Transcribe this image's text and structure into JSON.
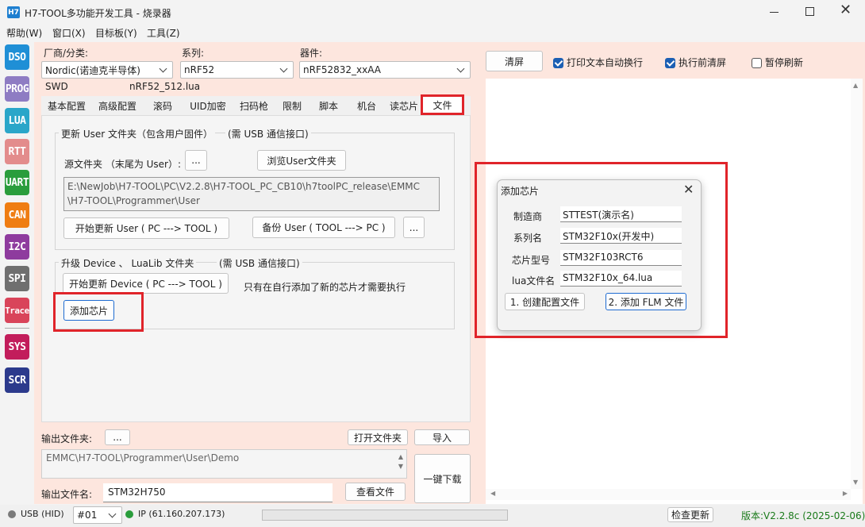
{
  "window": {
    "app_icon": "H7",
    "title": "H7-TOOL多功能开发工具 - 烧录器",
    "controls": [
      "minimize-icon",
      "maximize-icon",
      "close-icon"
    ]
  },
  "menu": [
    "帮助(W)",
    "窗口(X)",
    "目标板(Y)",
    "工具(Z)"
  ],
  "sidebar": [
    {
      "label": "DSO",
      "color": "#1f8fd6"
    },
    {
      "label": "PROG",
      "color": "#8e7cc3"
    },
    {
      "label": "LUA",
      "color": "#2aa6c9"
    },
    {
      "label": "RTT",
      "color": "#e38c8c"
    },
    {
      "label": "UART",
      "color": "#2a9d3c"
    },
    {
      "label": "CAN",
      "color": "#ef7d12"
    },
    {
      "label": "I2C",
      "color": "#8e3b9e"
    },
    {
      "label": "SPI",
      "color": "#6f6f6f"
    },
    {
      "label": "Trace",
      "color": "#d9445a"
    },
    {
      "label": "SYS",
      "color": "#c21d5b"
    },
    {
      "label": "SCR",
      "color": "#2c3a8c"
    }
  ],
  "selectors": {
    "vendor_label": "厂商/分类:",
    "vendor_value": "Nordic(诺迪克半导体)",
    "series_label": "系列:",
    "series_value": "nRF52",
    "device_label": "器件:",
    "device_value": "nRF52832_xxAA",
    "interface": "SWD",
    "lua_file": "nRF52_512.lua"
  },
  "tabs": [
    "基本配置",
    "高级配置",
    "滚码",
    "UID加密",
    "扫码枪",
    "限制",
    "脚本",
    "机台",
    "读芯片",
    "文件"
  ],
  "active_tab": "文件",
  "update_user": {
    "title": "更新 User 文件夹（包含用户固件）",
    "note": "(需 USB 通信接口)",
    "source_label": "源文件夹 （末尾为 User）:",
    "dots": "...",
    "browse": "浏览User文件夹",
    "path_line1": "E:\\NewJob\\H7-TOOL\\PC\\V2.2.8\\H7-TOOL_PC_CB10\\h7toolPC_release\\EMMC",
    "path_line2": "\\H7-TOOL\\Programmer\\User",
    "start_update": "开始更新 User ( PC ---> TOOL )",
    "backup": "备份 User ( TOOL ---> PC )",
    "more": "..."
  },
  "upgrade_device": {
    "title": "升级 Device 、 LuaLib 文件夹",
    "note": "(需 USB 通信接口)",
    "start": "开始更新 Device ( PC ---> TOOL )",
    "hint": "只有在自行添加了新的芯片才需要执行",
    "add_chip": "添加芯片"
  },
  "output": {
    "folder_label": "输出文件夹:",
    "folder_dots": "...",
    "open_folder": "打开文件夹",
    "import": "导入",
    "path": "EMMC\\H7-TOOL\\Programmer\\User\\Demo",
    "one_click": "一键下载",
    "name_label": "输出文件名:",
    "name_value": "STM32H750",
    "view_file": "查看文件"
  },
  "log": {
    "clear": "清屏",
    "auto_wrap": "打印文本自动换行",
    "auto_wrap_checked": true,
    "clear_before_exec": "执行前清屏",
    "clear_before_exec_checked": true,
    "pause_refresh": "暂停刷新",
    "pause_refresh_checked": false
  },
  "dialog": {
    "title": "添加芯片",
    "vendor_label": "制造商",
    "vendor_value": "STTEST(演示名)",
    "series_label": "系列名",
    "series_value": "STM32F10x(开发中)",
    "model_label": "芯片型号",
    "model_value": "STM32F103RCT6",
    "lua_label": "lua文件名",
    "lua_value": "STM32F10x_64.lua",
    "create_config": "1. 创建配置文件",
    "add_flm": "2. 添加 FLM 文件"
  },
  "status": {
    "usb": "USB (HID)",
    "port": "#01",
    "ip": "IP (61.160.207.173)",
    "check_update": "检查更新",
    "version": "版本:V2.2.8c (2025-02-06)",
    "version_color": "#1a7a1a"
  }
}
